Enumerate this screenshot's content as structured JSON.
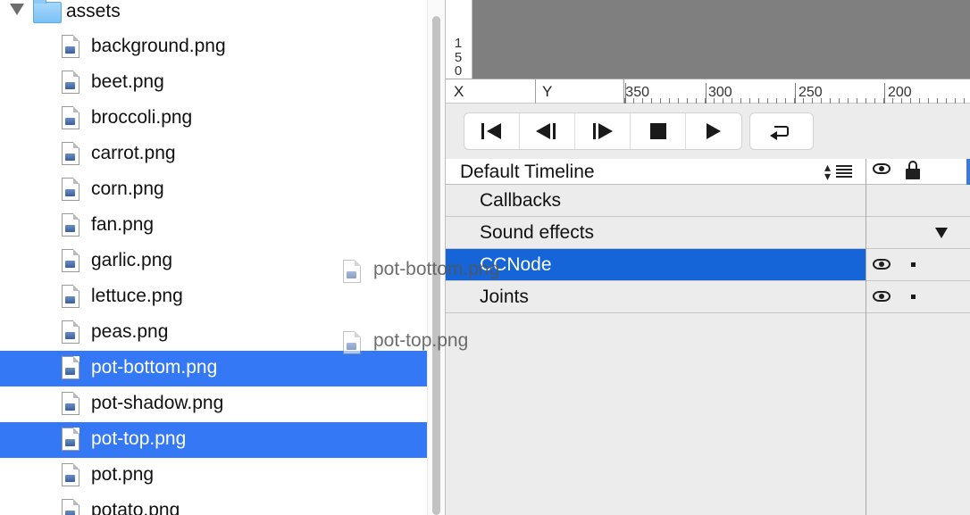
{
  "file_tree": {
    "folder": {
      "label": "assets",
      "expanded": true
    },
    "files": [
      {
        "label": "background.png",
        "selected": false
      },
      {
        "label": "beet.png",
        "selected": false
      },
      {
        "label": "broccoli.png",
        "selected": false
      },
      {
        "label": "carrot.png",
        "selected": false
      },
      {
        "label": "corn.png",
        "selected": false
      },
      {
        "label": "fan.png",
        "selected": false
      },
      {
        "label": "garlic.png",
        "selected": false
      },
      {
        "label": "lettuce.png",
        "selected": false
      },
      {
        "label": "peas.png",
        "selected": false
      },
      {
        "label": "pot-bottom.png",
        "selected": true
      },
      {
        "label": "pot-shadow.png",
        "selected": false
      },
      {
        "label": "pot-top.png",
        "selected": true
      },
      {
        "label": "pot.png",
        "selected": false
      },
      {
        "label": "potato.png",
        "selected": false
      }
    ]
  },
  "canvas": {
    "vertical_ruler_digits": [
      "1",
      "5",
      "0"
    ],
    "x_label": "X",
    "y_label": "Y",
    "ruler_numbers": [
      "350",
      "300",
      "250",
      "200"
    ]
  },
  "playback": {
    "icons": [
      "skip-to-start-icon",
      "step-back-icon",
      "step-forward-icon",
      "stop-icon",
      "play-icon",
      "loop-icon"
    ]
  },
  "timeline": {
    "selected_timeline": "Default Timeline",
    "rows": [
      {
        "label": "Callbacks",
        "visible": false,
        "locked": false,
        "expandable": false,
        "selected": false
      },
      {
        "label": "Sound effects",
        "visible": false,
        "locked": false,
        "expandable": true,
        "selected": false
      },
      {
        "label": "CCNode",
        "visible": true,
        "locked": true,
        "expandable": false,
        "selected": true
      },
      {
        "label": "Joints",
        "visible": true,
        "locked": true,
        "expandable": false,
        "selected": false
      }
    ]
  },
  "drag": {
    "items": [
      "pot-bottom.png",
      "pot-top.png"
    ]
  },
  "colors": {
    "selection_blue": "#3478f6",
    "timeline_selection_blue": "#1565d8",
    "canvas_gray": "#7f7f7f"
  }
}
